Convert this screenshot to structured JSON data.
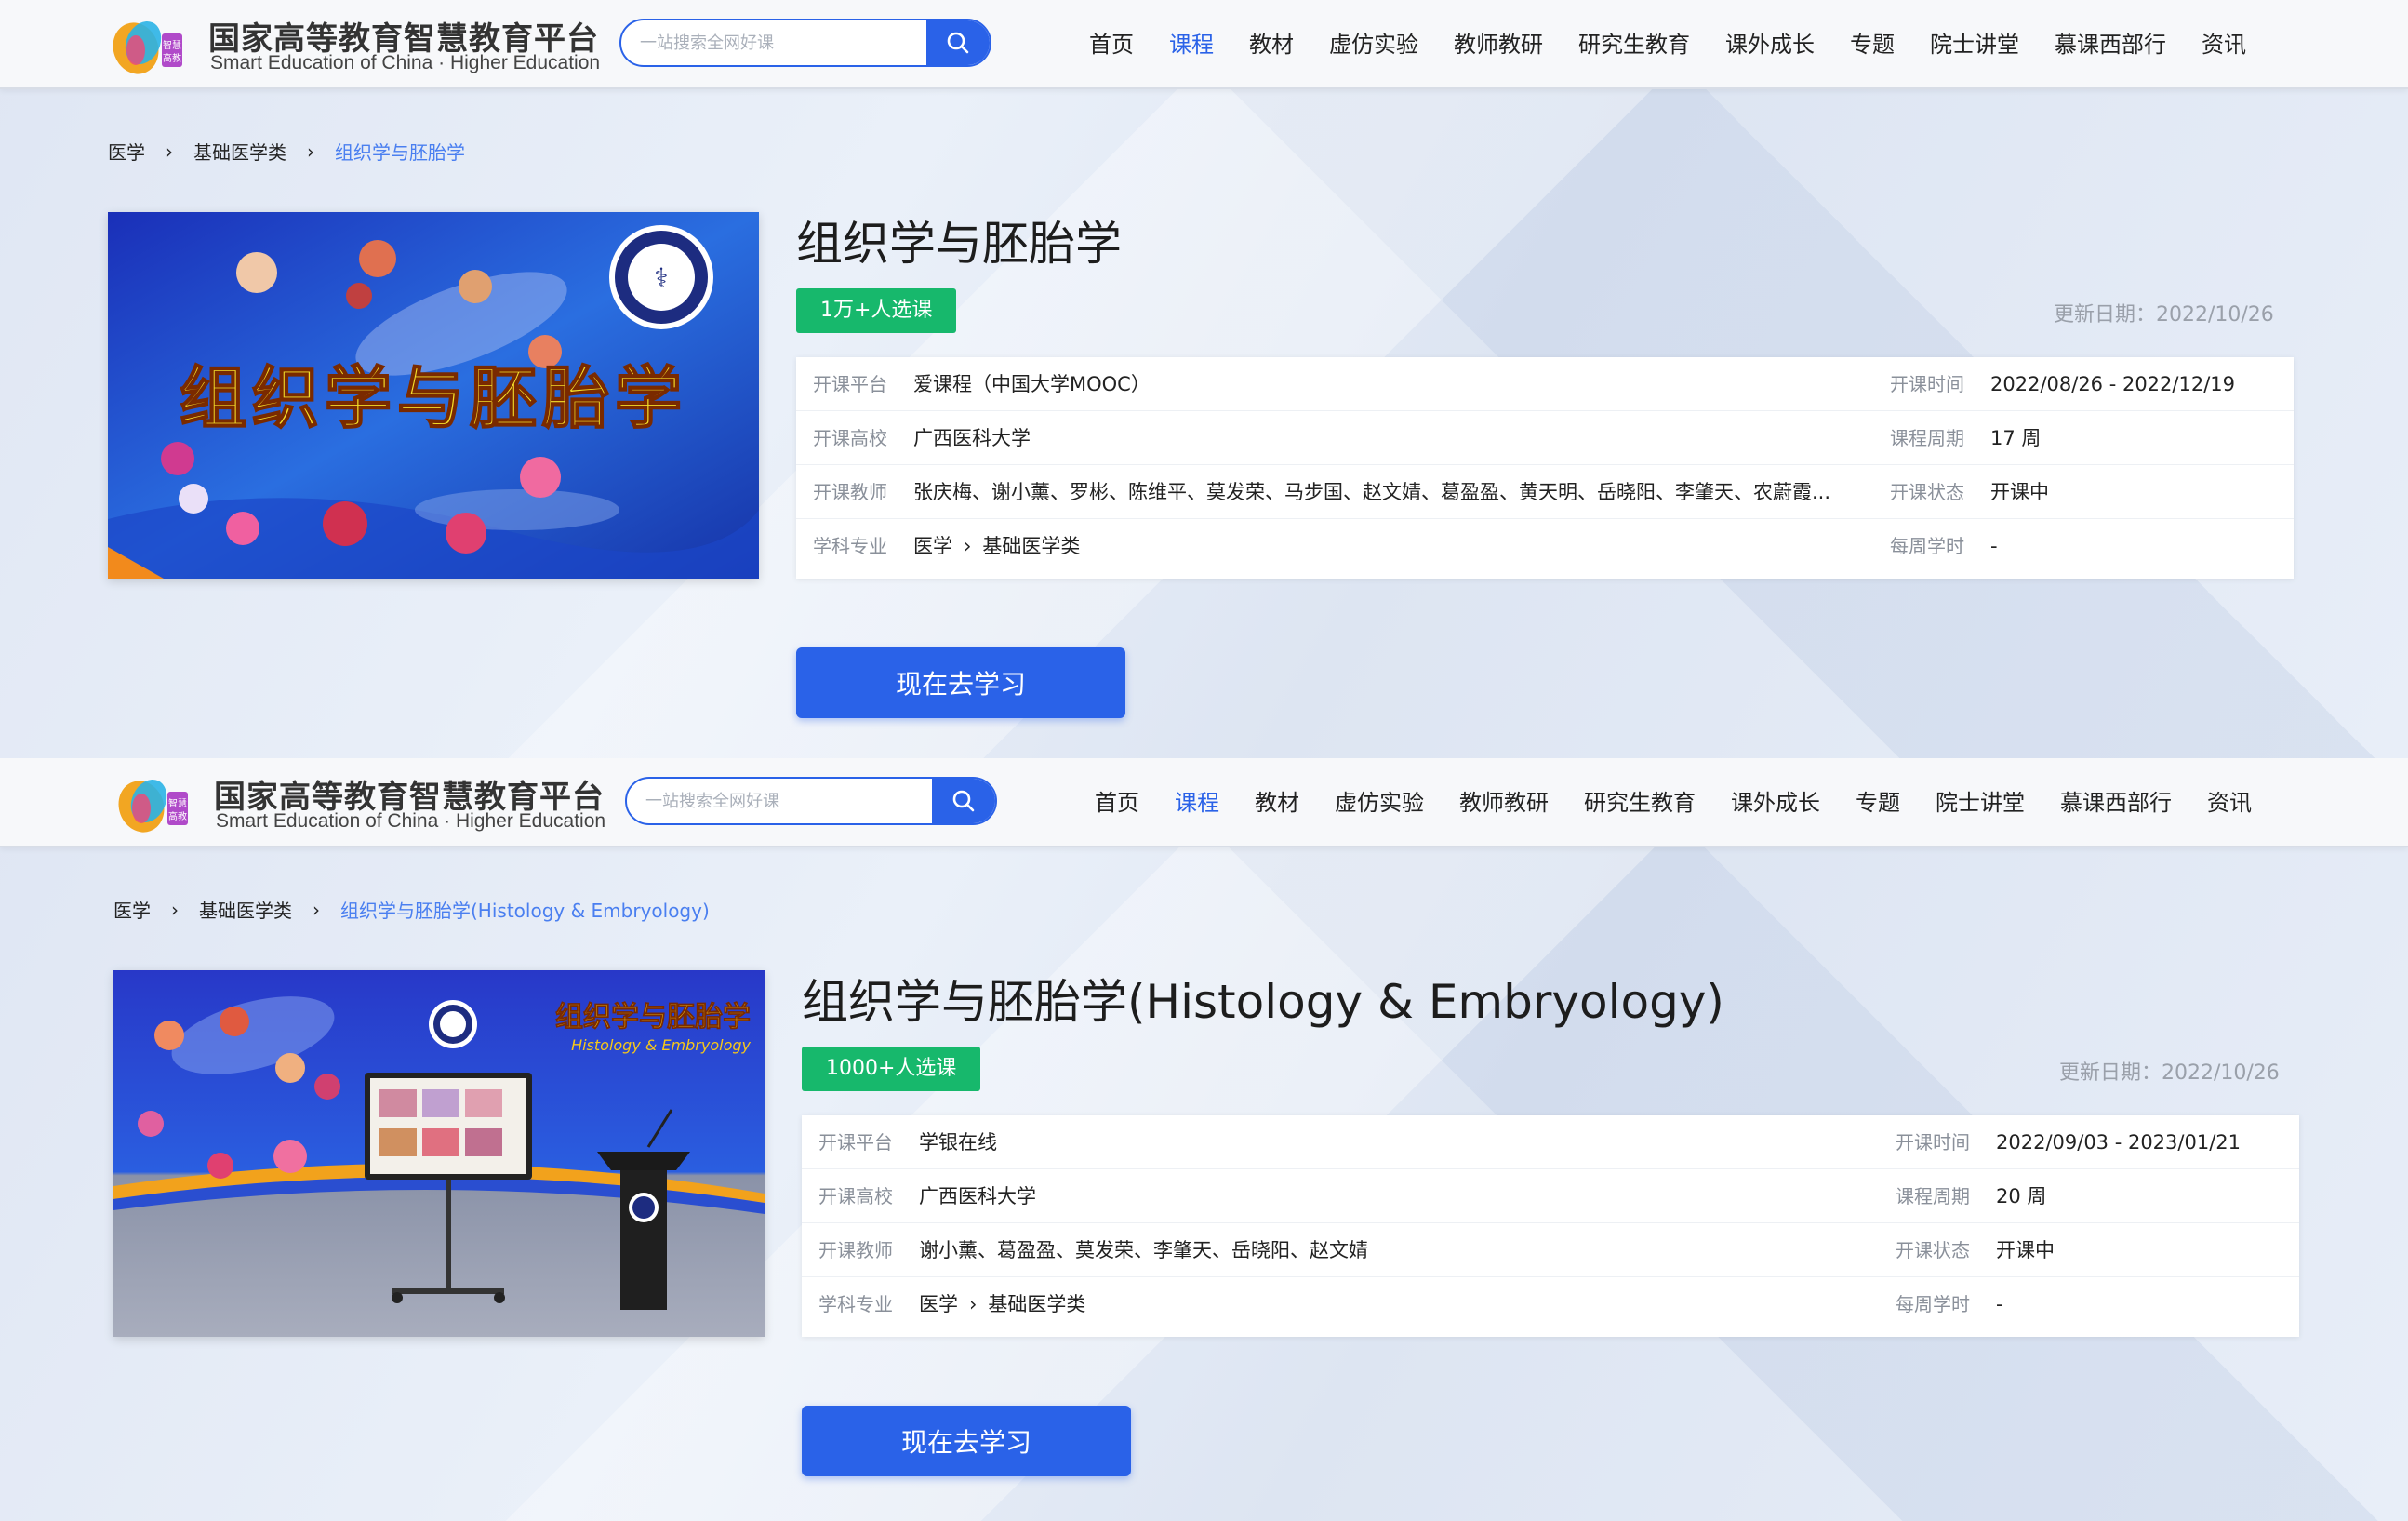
{
  "header": {
    "logo_title": "国家高等教育智慧教育平台",
    "logo_subtitle": "Smart Education of China · Higher Education",
    "search_placeholder": "一站搜索全网好课",
    "nav": [
      "首页",
      "课程",
      "教材",
      "虚仿实验",
      "教师教研",
      "研究生教育",
      "课外成长",
      "专题",
      "院士讲堂",
      "慕课西部行",
      "资讯"
    ],
    "active_nav": "课程"
  },
  "courses": [
    {
      "breadcrumb": [
        "医学",
        "基础医学类",
        "组织学与胚胎学"
      ],
      "cover_text": "组织学与胚胎学",
      "title": "组织学与胚胎学",
      "enroll": "1万+人选课",
      "update_date": "更新日期：2022/10/26",
      "info": {
        "platform_label": "开课平台",
        "platform": "爱课程（中国大学MOOC）",
        "school_label": "开课高校",
        "school": "广西医科大学",
        "teacher_label": "开课教师",
        "teachers": "张庆梅、谢小薰、罗彬、陈维平、莫发荣、马步国、赵文婧、葛盈盈、黄天明、岳晓阳、李肇天、农蔚霞...",
        "subject_label": "学科专业",
        "subject_main": "医学",
        "subject_sub": "基础医学类",
        "time_label": "开课时间",
        "time": "2022/08/26 - 2022/12/19",
        "period_label": "课程周期",
        "period": "17 周",
        "status_label": "开课状态",
        "status": "开课中",
        "weekly_label": "每周学时",
        "weekly": "-"
      },
      "button": "现在去学习"
    },
    {
      "breadcrumb": [
        "医学",
        "基础医学类",
        "组织学与胚胎学(Histology & Embryology)"
      ],
      "cover_text": "组织学与胚胎学",
      "cover_subtext": "Histology & Embryology",
      "title": "组织学与胚胎学(Histology & Embryology)",
      "enroll": "1000+人选课",
      "update_date": "更新日期：2022/10/26",
      "info": {
        "platform_label": "开课平台",
        "platform": "学银在线",
        "school_label": "开课高校",
        "school": "广西医科大学",
        "teacher_label": "开课教师",
        "teachers": "谢小薰、葛盈盈、莫发荣、李肇天、岳晓阳、赵文婧",
        "subject_label": "学科专业",
        "subject_main": "医学",
        "subject_sub": "基础医学类",
        "time_label": "开课时间",
        "time": "2022/09/03 - 2023/01/21",
        "period_label": "课程周期",
        "period": "20 周",
        "status_label": "开课状态",
        "status": "开课中",
        "weekly_label": "每周学时",
        "weekly": "-"
      },
      "button": "现在去学习"
    }
  ],
  "colors": {
    "accent": "#2a62e8",
    "badge": "#17b86c",
    "link": "#4a7ff0"
  }
}
